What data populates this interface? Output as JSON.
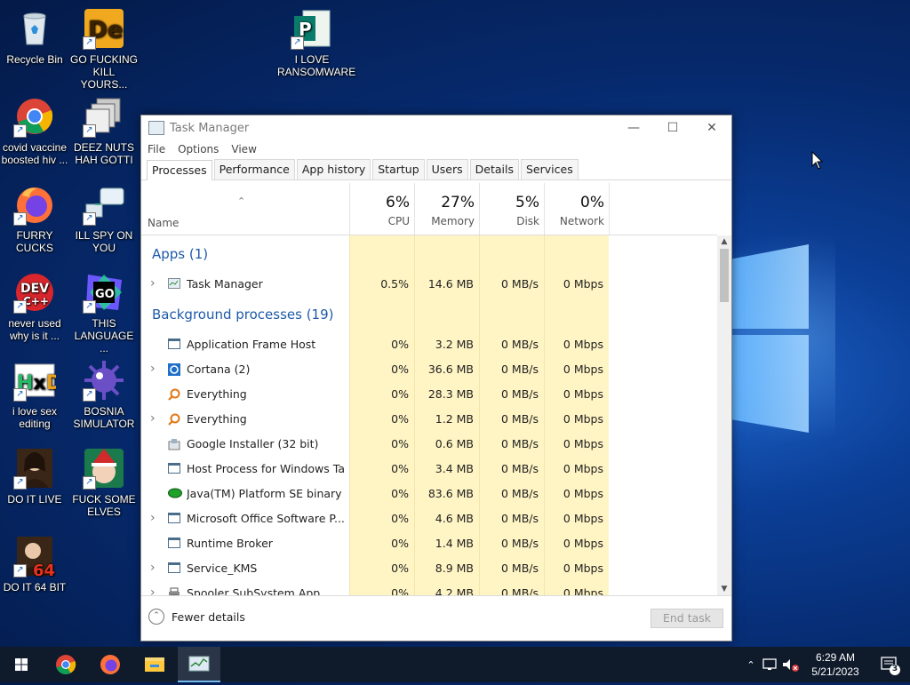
{
  "desktop": {
    "icons": [
      {
        "label": "Recycle Bin",
        "icon": "recycle-bin-icon"
      },
      {
        "label": "GO FUCKING KILL YOURS...",
        "icon": "de-app-icon"
      },
      {
        "label": "I LOVE RANSOMWARE",
        "icon": "publisher-icon"
      },
      {
        "label": "covid vaccine boosted hiv ...",
        "icon": "chrome-icon"
      },
      {
        "label": "DEEZ NUTS HAH GOTTI",
        "icon": "stacked-windows-icon"
      },
      {
        "label": "FURRY CUCKS",
        "icon": "firefox-icon"
      },
      {
        "label": "ILL SPY ON YOU",
        "icon": "network-computer-icon"
      },
      {
        "label": "never used why is it ...",
        "icon": "dev-cpp-icon"
      },
      {
        "label": "THIS LANGUAGE ...",
        "icon": "goland-icon"
      },
      {
        "label": "i love sex editing",
        "icon": "hxd-icon"
      },
      {
        "label": "BOSNIA SIMULATOR",
        "icon": "mine-icon"
      },
      {
        "label": "DO IT LIVE",
        "icon": "portrait-icon"
      },
      {
        "label": "FUCK SOME ELVES",
        "icon": "elf-game-icon"
      },
      {
        "label": "DO IT 64 BIT",
        "icon": "portrait-64-icon"
      }
    ]
  },
  "taskmanager": {
    "title": "Task Manager",
    "menu": [
      "File",
      "Options",
      "View"
    ],
    "tabs": [
      "Processes",
      "Performance",
      "App history",
      "Startup",
      "Users",
      "Details",
      "Services"
    ],
    "active_tab": "Processes",
    "header": {
      "name": "Name",
      "cpu": {
        "pct": "6%",
        "label": "CPU"
      },
      "memory": {
        "pct": "27%",
        "label": "Memory"
      },
      "disk": {
        "pct": "5%",
        "label": "Disk"
      },
      "network": {
        "pct": "0%",
        "label": "Network"
      }
    },
    "groups": {
      "apps": "Apps (1)",
      "background": "Background processes (19)"
    },
    "apps": [
      {
        "name": "Task Manager",
        "cpu": "0.5%",
        "memory": "14.6 MB",
        "disk": "0 MB/s",
        "network": "0 Mbps",
        "expand": true,
        "icon": "task-manager-icon"
      }
    ],
    "background": [
      {
        "name": "Application Frame Host",
        "cpu": "0%",
        "memory": "3.2 MB",
        "disk": "0 MB/s",
        "network": "0 Mbps",
        "expand": false,
        "icon": "window-icon"
      },
      {
        "name": "Cortana (2)",
        "cpu": "0%",
        "memory": "36.6 MB",
        "disk": "0 MB/s",
        "network": "0 Mbps",
        "expand": true,
        "icon": "cortana-icon"
      },
      {
        "name": "Everything",
        "cpu": "0%",
        "memory": "28.3 MB",
        "disk": "0 MB/s",
        "network": "0 Mbps",
        "expand": false,
        "icon": "search-magnifier-icon"
      },
      {
        "name": "Everything",
        "cpu": "0%",
        "memory": "1.2 MB",
        "disk": "0 MB/s",
        "network": "0 Mbps",
        "expand": true,
        "icon": "search-magnifier-icon"
      },
      {
        "name": "Google Installer (32 bit)",
        "cpu": "0%",
        "memory": "0.6 MB",
        "disk": "0 MB/s",
        "network": "0 Mbps",
        "expand": false,
        "icon": "installer-icon"
      },
      {
        "name": "Host Process for Windows Ta...",
        "cpu": "0%",
        "memory": "3.4 MB",
        "disk": "0 MB/s",
        "network": "0 Mbps",
        "expand": false,
        "icon": "window-icon"
      },
      {
        "name": "Java(TM) Platform SE binary ...",
        "cpu": "0%",
        "memory": "83.6 MB",
        "disk": "0 MB/s",
        "network": "0 Mbps",
        "expand": false,
        "icon": "java-icon"
      },
      {
        "name": "Microsoft Office Software P...",
        "cpu": "0%",
        "memory": "4.6 MB",
        "disk": "0 MB/s",
        "network": "0 Mbps",
        "expand": true,
        "icon": "window-icon"
      },
      {
        "name": "Runtime Broker",
        "cpu": "0%",
        "memory": "1.4 MB",
        "disk": "0 MB/s",
        "network": "0 Mbps",
        "expand": false,
        "icon": "window-icon"
      },
      {
        "name": "Service_KMS",
        "cpu": "0%",
        "memory": "8.9 MB",
        "disk": "0 MB/s",
        "network": "0 Mbps",
        "expand": true,
        "icon": "window-icon"
      },
      {
        "name": "Spooler SubSystem App",
        "cpu": "0%",
        "memory": "4.2 MB",
        "disk": "0 MB/s",
        "network": "0 Mbps",
        "expand": true,
        "icon": "printer-icon"
      }
    ],
    "footer": {
      "fewer_details": "Fewer details",
      "end_task": "End task"
    }
  },
  "taskbar": {
    "pinned": [
      "start-icon",
      "chrome-icon",
      "firefox-icon",
      "file-explorer-icon",
      "task-manager-icon"
    ],
    "time": "6:29 AM",
    "date": "5/21/2023",
    "notification_count": "3"
  }
}
